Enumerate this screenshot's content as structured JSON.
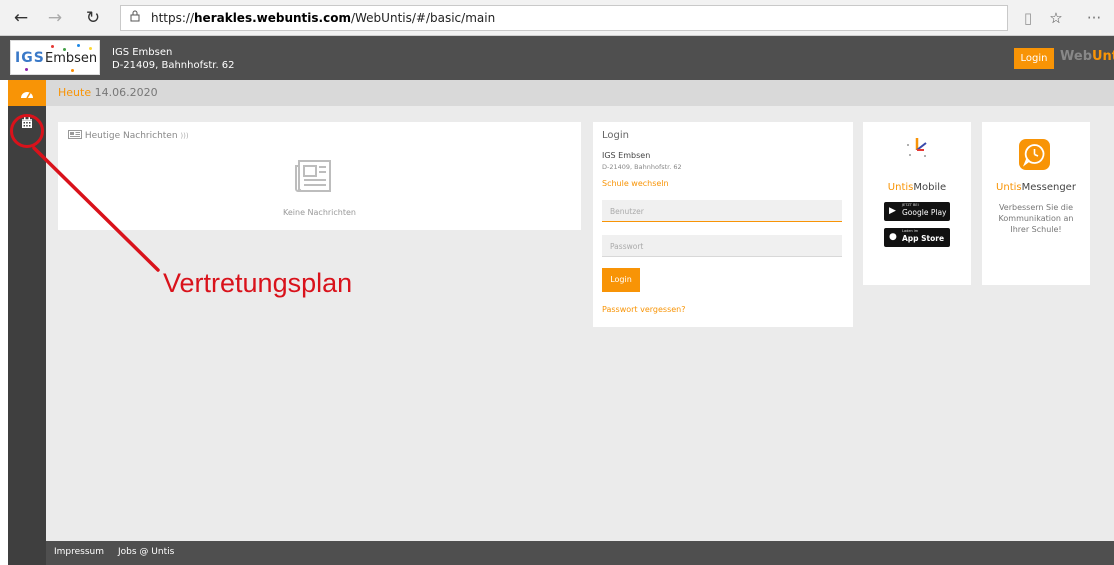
{
  "browser": {
    "back_glyph": "←",
    "forward_glyph": "→",
    "refresh_glyph": "↻",
    "url_prefix": "https://",
    "url_host": "herakles.webuntis.com",
    "url_path": "/WebUntis/#/basic/main",
    "reading_view_glyph": "▯",
    "favorite_glyph": "☆",
    "more_glyph": "···"
  },
  "header": {
    "logo_igs": "IGS",
    "logo_embsen": "Embsen",
    "school_name": "IGS Embsen",
    "school_address": "D-21409, Bahnhofstr. 62",
    "login_label": "Login",
    "brand_web": "Web",
    "brand_untis": "Untis"
  },
  "sidebar": {
    "items": [
      {
        "icon": "dashboard-icon",
        "glyph": "◕"
      },
      {
        "icon": "calendar-icon",
        "glyph": "▦"
      }
    ]
  },
  "datebar": {
    "label": "Heute",
    "date": "14.06.2020"
  },
  "news": {
    "title": "Heutige Nachrichten",
    "rss_glyph": "☰",
    "empty": "Keine Nachrichten"
  },
  "login": {
    "title": "Login",
    "school": "IGS Embsen",
    "address": "D-21409, Bahnhofstr. 62",
    "change_school": "Schule wechseln",
    "username_placeholder": "Benutzer",
    "password_placeholder": "Passwort",
    "button": "Login",
    "forgot": "Passwort vergessen?"
  },
  "mobile": {
    "title_untis": "Untis",
    "title_mobile": "Mobile",
    "google_small": "JETZT BEI",
    "google_big": "Google Play",
    "apple_small": "Laden im",
    "apple_big": "App Store"
  },
  "messenger": {
    "title_untis": "Untis",
    "title_messenger": "Messenger",
    "description": "Verbessern Sie die Kommunikation an Ihrer Schule!"
  },
  "footer": {
    "impressum": "Impressum",
    "jobs": "Jobs @ Untis"
  },
  "annotation": {
    "text": "Vertretungsplan",
    "color": "#d9121b"
  },
  "colors": {
    "accent": "#f89406",
    "topbar": "#4f4f4f",
    "sidebar": "#3f3f3f",
    "background": "#ebebeb"
  }
}
